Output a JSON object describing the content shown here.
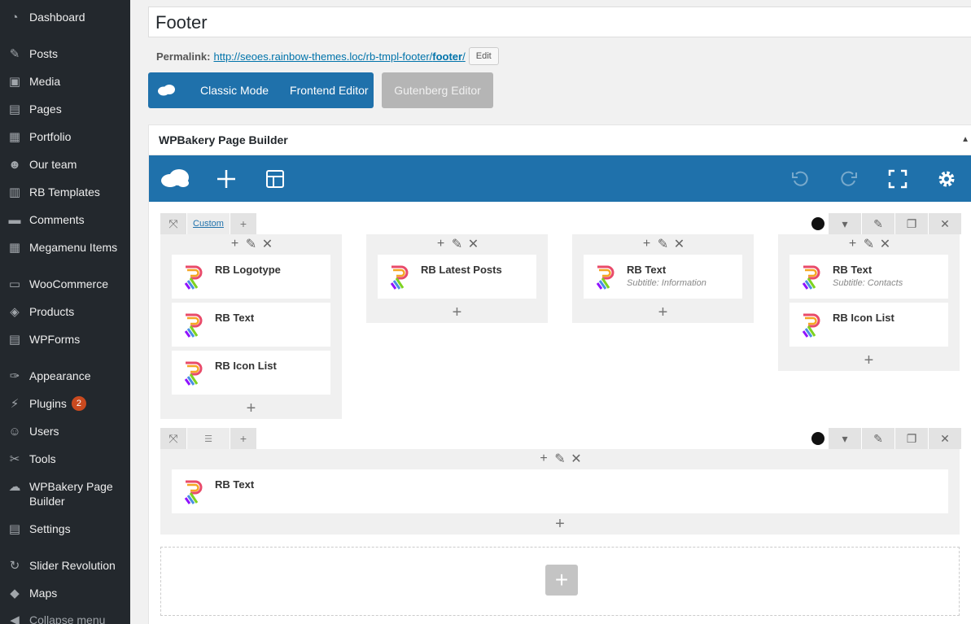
{
  "sidebar": {
    "items": [
      {
        "label": "Dashboard",
        "icon": "dashboard-icon",
        "glyph": "◔"
      },
      {
        "label": "Posts",
        "icon": "pin-icon",
        "glyph": "✎"
      },
      {
        "label": "Media",
        "icon": "media-icon",
        "glyph": "▣"
      },
      {
        "label": "Pages",
        "icon": "pages-icon",
        "glyph": "▤"
      },
      {
        "label": "Portfolio",
        "icon": "portfolio-icon",
        "glyph": "▦"
      },
      {
        "label": "Our team",
        "icon": "team-icon",
        "glyph": "☻"
      },
      {
        "label": "RB Templates",
        "icon": "calendar-icon",
        "glyph": "▥"
      },
      {
        "label": "Comments",
        "icon": "comment-icon",
        "glyph": "▬"
      },
      {
        "label": "Megamenu Items",
        "icon": "grid-icon",
        "glyph": "▦"
      },
      {
        "label": "WooCommerce",
        "icon": "woo-icon",
        "glyph": "▭"
      },
      {
        "label": "Products",
        "icon": "box-icon",
        "glyph": "◈"
      },
      {
        "label": "WPForms",
        "icon": "forms-icon",
        "glyph": "▤"
      },
      {
        "label": "Appearance",
        "icon": "brush-icon",
        "glyph": "✑"
      },
      {
        "label": "Plugins",
        "icon": "plug-icon",
        "glyph": "⚡",
        "badge": "2"
      },
      {
        "label": "Users",
        "icon": "user-icon",
        "glyph": "☺"
      },
      {
        "label": "Tools",
        "icon": "wrench-icon",
        "glyph": "✂"
      },
      {
        "label": "WPBakery Page Builder",
        "icon": "cloud-icon",
        "glyph": "☁"
      },
      {
        "label": "Settings",
        "icon": "settings-icon",
        "glyph": "▤"
      },
      {
        "label": "Slider Revolution",
        "icon": "refresh-icon",
        "glyph": "↻"
      },
      {
        "label": "Maps",
        "icon": "map-icon",
        "glyph": "◆"
      },
      {
        "label": "Collapse menu",
        "icon": "collapse-icon",
        "glyph": "◀"
      }
    ]
  },
  "post": {
    "title": "Footer",
    "permalink_label": "Permalink:",
    "permalink_base": "http://seoes.rainbow-themes.loc/rb-tmpl-footer/",
    "permalink_slug": "footer",
    "permalink_tail": "/",
    "edit_label": "Edit"
  },
  "modes": {
    "classic": "Classic Mode",
    "frontend": "Frontend Editor",
    "gutenberg": "Gutenberg Editor"
  },
  "builder": {
    "title": "WPBakery Page Builder",
    "row1_layout_label": "Custom",
    "columns": [
      {
        "elements": [
          {
            "title": "RB Logotype",
            "sub": ""
          },
          {
            "title": "RB Text",
            "sub": ""
          },
          {
            "title": "RB Icon List",
            "sub": ""
          }
        ]
      },
      {
        "elements": [
          {
            "title": "RB Latest Posts",
            "sub": ""
          }
        ]
      },
      {
        "elements": [
          {
            "title": "RB Text",
            "sub": "Subtitle: Information"
          }
        ]
      },
      {
        "elements": [
          {
            "title": "RB Text",
            "sub": "Subtitle: Contacts"
          },
          {
            "title": "RB Icon List",
            "sub": ""
          }
        ]
      }
    ],
    "row2": {
      "elements": [
        {
          "title": "RB Text",
          "sub": ""
        }
      ]
    }
  },
  "colors": {
    "sidebar_bg": "#23282d",
    "accent": "#1f71ab",
    "badge": "#ca4a1f"
  }
}
